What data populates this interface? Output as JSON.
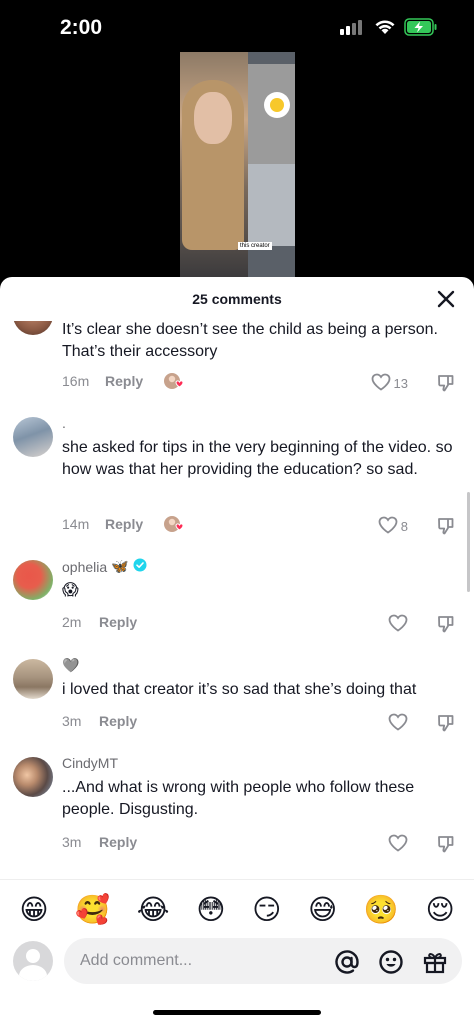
{
  "status_bar": {
    "time": "2:00",
    "icons": [
      "cellular-signal-icon",
      "wifi-icon",
      "battery-charging-icon"
    ],
    "battery_color": "#34c759"
  },
  "video": {
    "caption": "this creator"
  },
  "sheet": {
    "title": "25 comments"
  },
  "comments": [
    {
      "username": "",
      "text": "It’s clear she doesn’t see the child as being a person. That’s their accessory",
      "time": "16m",
      "reply_label": "Reply",
      "creator_liked": true,
      "likes": "13"
    },
    {
      "username": ".",
      "text": "she asked for tips in the very beginning of the video. so how was that her providing the education? so sad.",
      "time": "14m",
      "reply_label": "Reply",
      "creator_liked": true,
      "likes": "8"
    },
    {
      "username": "ophelia",
      "username_emoji": "🦋",
      "verified": true,
      "text": "😱",
      "time": "2m",
      "reply_label": "Reply",
      "creator_liked": false,
      "likes": ""
    },
    {
      "username": "🩶",
      "text": "i loved that creator it’s so sad that she’s doing that",
      "time": "3m",
      "reply_label": "Reply",
      "creator_liked": false,
      "likes": ""
    },
    {
      "username": "CindyMT",
      "text": "...And what is wrong with people who follow these people. Disgusting.",
      "time": "3m",
      "reply_label": "Reply",
      "creator_liked": false,
      "likes": ""
    }
  ],
  "emoji_bar": [
    "😁",
    "🥰",
    "😂",
    "😳",
    "😏",
    "😅",
    "🥺",
    "😌"
  ],
  "input": {
    "placeholder": "Add comment...",
    "icons": [
      "at-mention-icon",
      "emoji-icon",
      "gift-icon"
    ]
  },
  "colors": {
    "verified": "#20d5ec",
    "heart_badge": "#fe2c55",
    "text_primary": "#161823",
    "text_secondary": "#8a8b91"
  }
}
